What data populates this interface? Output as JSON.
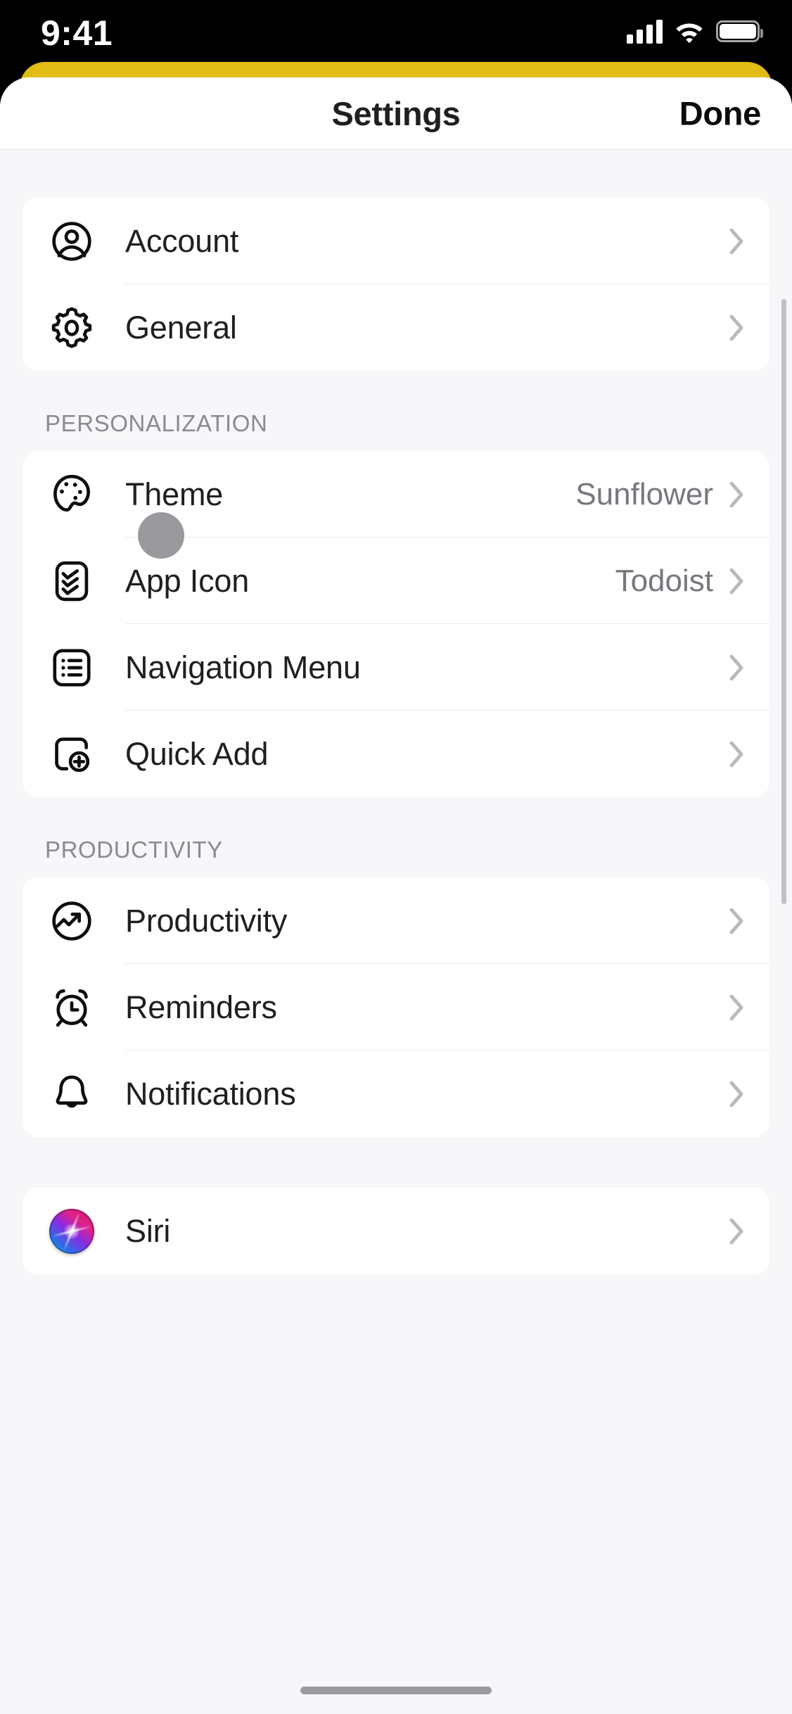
{
  "status_bar": {
    "time": "9:41",
    "cellular_icon": "cellular-signal-icon",
    "wifi_icon": "wifi-icon",
    "battery_icon": "battery-full-icon"
  },
  "nav": {
    "title": "Settings",
    "done_label": "Done"
  },
  "colors": {
    "accent_yellow": "#E0BC14",
    "page_background": "#F7F7F9",
    "card_background": "#FFFFFF",
    "primary_text": "#1F1F21",
    "secondary_text": "#77777E",
    "section_label": "#8A8A90",
    "chevron": "#B8B8BE",
    "separator": "#EAEAEC",
    "touch_indicator": "#9A9A9E"
  },
  "sections": [
    {
      "label": null,
      "rows": [
        {
          "icon": "person-circle-icon",
          "label": "Account",
          "value": null,
          "chevron": true
        },
        {
          "icon": "gear-icon",
          "label": "General",
          "value": null,
          "chevron": true
        }
      ]
    },
    {
      "label": "PERSONALIZATION",
      "rows": [
        {
          "icon": "palette-icon",
          "label": "Theme",
          "value": "Sunflower",
          "chevron": true
        },
        {
          "icon": "app-icon-badge-icon",
          "label": "App Icon",
          "value": "Todoist",
          "chevron": true
        },
        {
          "icon": "list-menu-icon",
          "label": "Navigation Menu",
          "value": null,
          "chevron": true
        },
        {
          "icon": "quick-add-plus-icon",
          "label": "Quick Add",
          "value": null,
          "chevron": true
        }
      ]
    },
    {
      "label": "PRODUCTIVITY",
      "rows": [
        {
          "icon": "trending-up-circle-icon",
          "label": "Productivity",
          "value": null,
          "chevron": true
        },
        {
          "icon": "alarm-clock-icon",
          "label": "Reminders",
          "value": null,
          "chevron": true
        },
        {
          "icon": "bell-icon",
          "label": "Notifications",
          "value": null,
          "chevron": true
        }
      ]
    },
    {
      "label": null,
      "rows": [
        {
          "icon": "siri-orb-icon",
          "label": "Siri",
          "value": null,
          "chevron": true
        }
      ]
    }
  ],
  "overlay": {
    "touch_indicator": "touch-point-indicator",
    "scrollbar": "vertical-scrollbar",
    "home_indicator": "home-indicator"
  }
}
